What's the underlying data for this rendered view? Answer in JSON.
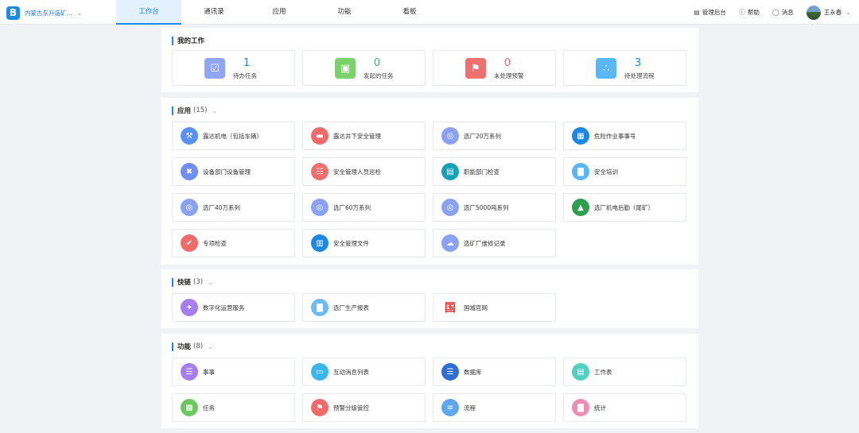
{
  "header": {
    "org_name": "内蒙古东升庙矿...",
    "nav": [
      "工作台",
      "通讯录",
      "应用",
      "功能",
      "看板"
    ],
    "active_nav": "工作台",
    "tools": [
      {
        "label": "管理后台",
        "icon": "monitor-icon"
      },
      {
        "label": "帮助",
        "icon": "help-icon"
      },
      {
        "label": "消息",
        "icon": "message-icon"
      }
    ],
    "user_name": "王永春"
  },
  "work": {
    "title": "我的工作",
    "items": [
      {
        "count": "1",
        "label": "待办任务",
        "color": "#8fa5f7",
        "num_color": "#1e88e5",
        "icon": "calendar-check-icon"
      },
      {
        "count": "0",
        "label": "发起的任务",
        "color": "#7cd26a",
        "num_color": "#3cb371",
        "icon": "briefcase-icon"
      },
      {
        "count": "0",
        "label": "未处理预警",
        "color": "#f07070",
        "num_color": "#f06262",
        "icon": "bell-icon"
      },
      {
        "count": "3",
        "label": "待处理流程",
        "color": "#5bb7f3",
        "num_color": "#1e88e5",
        "icon": "flow-icon"
      }
    ]
  },
  "apps": {
    "title": "应用",
    "count": "(15)",
    "items": [
      {
        "label": "露达机电（包括车辆）",
        "color": "#5b8ff9",
        "icon": "drill-icon"
      },
      {
        "label": "露达井下安全管理",
        "color": "#f26b6b",
        "icon": "truck-icon"
      },
      {
        "label": "选厂20万系列",
        "color": "#8aa2f5",
        "icon": "camera-icon"
      },
      {
        "label": "危险作业事事号",
        "color": "#1e88e5",
        "icon": "grid-icon"
      },
      {
        "label": "设备部门设备管理",
        "color": "#6d8ff6",
        "icon": "tools-icon"
      },
      {
        "label": "安全管理人员巡检",
        "color": "#f07070",
        "icon": "org-icon"
      },
      {
        "label": "职能部门检查",
        "color": "#17a2b8",
        "icon": "table-icon"
      },
      {
        "label": "安全培训",
        "color": "#5bb7f3",
        "icon": "chart-icon"
      },
      {
        "label": "选厂40万系列",
        "color": "#8aa2f5",
        "icon": "camera-icon"
      },
      {
        "label": "选厂60万系列",
        "color": "#8aa2f5",
        "icon": "camera-icon"
      },
      {
        "label": "选厂5000吨系列",
        "color": "#8aa2f5",
        "icon": "camera-icon"
      },
      {
        "label": "选厂机电后勤（尾矿）",
        "color": "#2e9e4f",
        "icon": "mountain-icon"
      },
      {
        "label": "专项检查",
        "color": "#f26b6b",
        "icon": "check-box-icon"
      },
      {
        "label": "安全管理文件",
        "color": "#1e88e5",
        "icon": "document-icon"
      },
      {
        "label": "选矿厂维修记录",
        "color": "#8aa2f5",
        "icon": "cloud-upload-icon"
      }
    ]
  },
  "links": {
    "title": "快链",
    "count": "(3)",
    "items": [
      {
        "label": "数字化运营服务",
        "color": "#a77ef0",
        "icon": "satellite-icon"
      },
      {
        "label": "选厂生产报表",
        "color": "#6bbcf5",
        "icon": "chart-icon"
      },
      {
        "label": "国城官网",
        "color": "#e03030",
        "icon": "guocheng-logo-icon"
      }
    ]
  },
  "functions": {
    "title": "功能",
    "count": "(8)",
    "items": [
      {
        "label": "事事",
        "color": "#a77ef0",
        "icon": "list-icon"
      },
      {
        "label": "互动消息列表",
        "color": "#39b6ec",
        "icon": "chat-icon"
      },
      {
        "label": "数据库",
        "color": "#2f6fd0",
        "icon": "database-icon"
      },
      {
        "label": "工作表",
        "color": "#4fd0c0",
        "icon": "sheet-icon"
      },
      {
        "label": "任务",
        "color": "#6dc761",
        "icon": "book-icon"
      },
      {
        "label": "预警分级管控",
        "color": "#f26b6b",
        "icon": "bell-icon"
      },
      {
        "label": "流程",
        "color": "#5fa8f0",
        "icon": "flow-lines-icon"
      },
      {
        "label": "统计",
        "color": "#f28ab6",
        "icon": "stats-icon"
      }
    ]
  }
}
